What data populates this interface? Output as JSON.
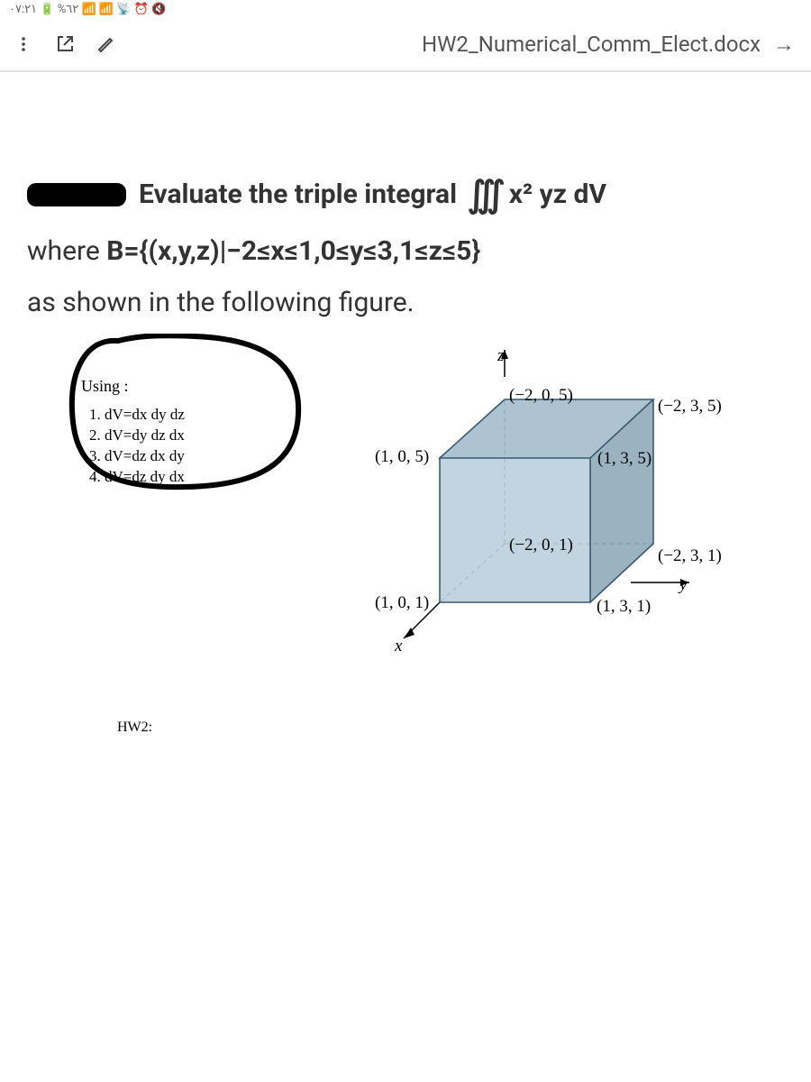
{
  "statusbar": {
    "text": "۰۷:۲۱ 🔋 %٦٢ 📶 📶 📡 ⏰ 🔇"
  },
  "appbar": {
    "title": "HW2_Numerical_Comm_Elect.docx"
  },
  "problem": {
    "prefix": "Evaluate the triple integral",
    "integral_expr": "x² yz dV",
    "line2_pre": "where ",
    "line2_set": "B={(x,y,z)|−2≤x≤1,0≤y≤3,1≤z≤5}",
    "line3": "as shown in the following figure."
  },
  "using": {
    "title": "Using :",
    "items": [
      "dV=dx dy dz",
      "dV=dy dz dx",
      "dV=dz dx dy",
      "dV=dz dy dx"
    ]
  },
  "coords": {
    "z": "z",
    "x": "x",
    "y": "y",
    "ftl": "(−2, 0, 5)",
    "ftr": "(−2, 3, 5)",
    "ffl": "(1, 0, 5)",
    "ffr": "(1, 3, 5)",
    "btl": "(−2, 0, 1)",
    "btr": "(−2, 3, 1)",
    "bfl": "(1, 0, 1)",
    "bfr": "(1, 3, 1)"
  },
  "hw2": "HW2:"
}
